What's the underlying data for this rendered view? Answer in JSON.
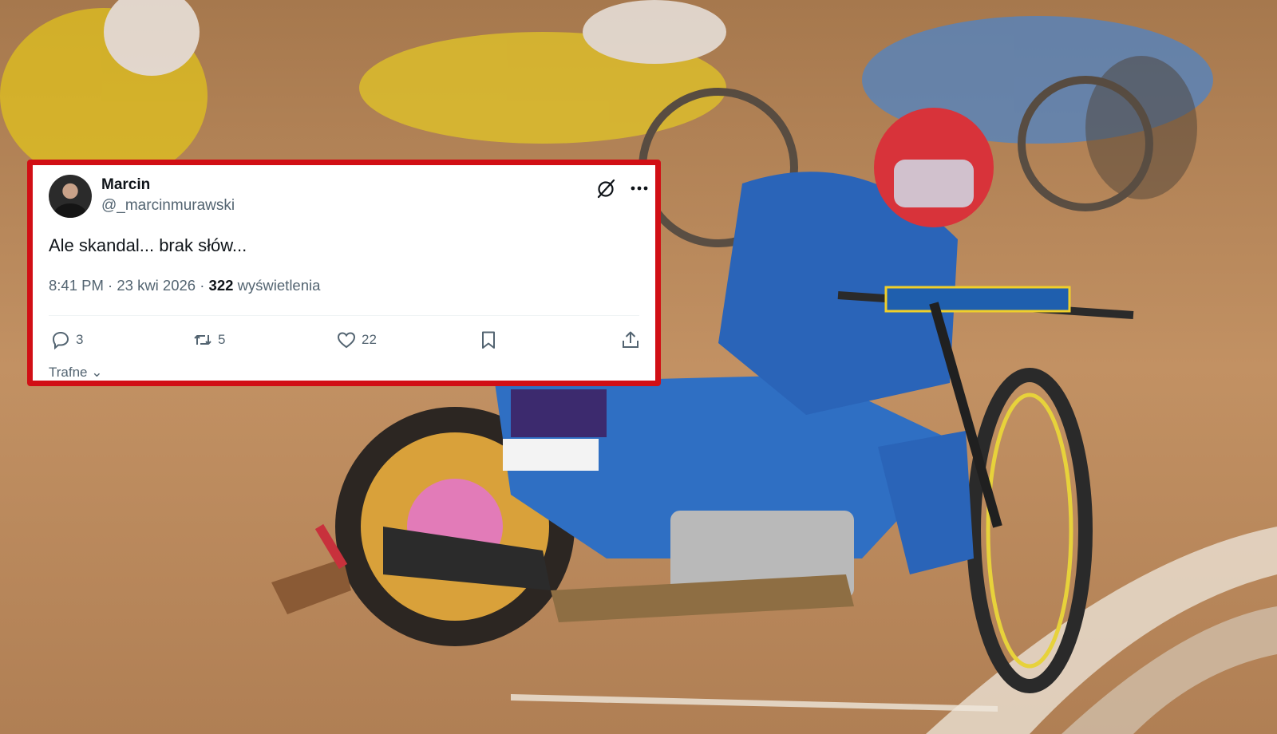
{
  "tweet": {
    "display_name": "Marcin",
    "handle": "@_marcinmurawski",
    "text": "Ale skandal... brak słów...",
    "time": "8:41 PM",
    "separator": "·",
    "date": "23 kwi 2026",
    "views_count": "322",
    "views_label": "wyświetlenia",
    "replies": "3",
    "retweets": "5",
    "likes": "22",
    "sort_label": "Trafne"
  },
  "icons": {
    "grok": "grok-icon",
    "more": "more-icon",
    "reply": "reply-icon",
    "retweet": "retweet-icon",
    "like": "like-icon",
    "bookmark": "bookmark-icon",
    "share": "share-icon",
    "sort": "chevron-down-icon"
  },
  "colors": {
    "frame": "#d10f15",
    "text": "#0f1419",
    "muted": "#536471",
    "track": "#b98a5c"
  }
}
